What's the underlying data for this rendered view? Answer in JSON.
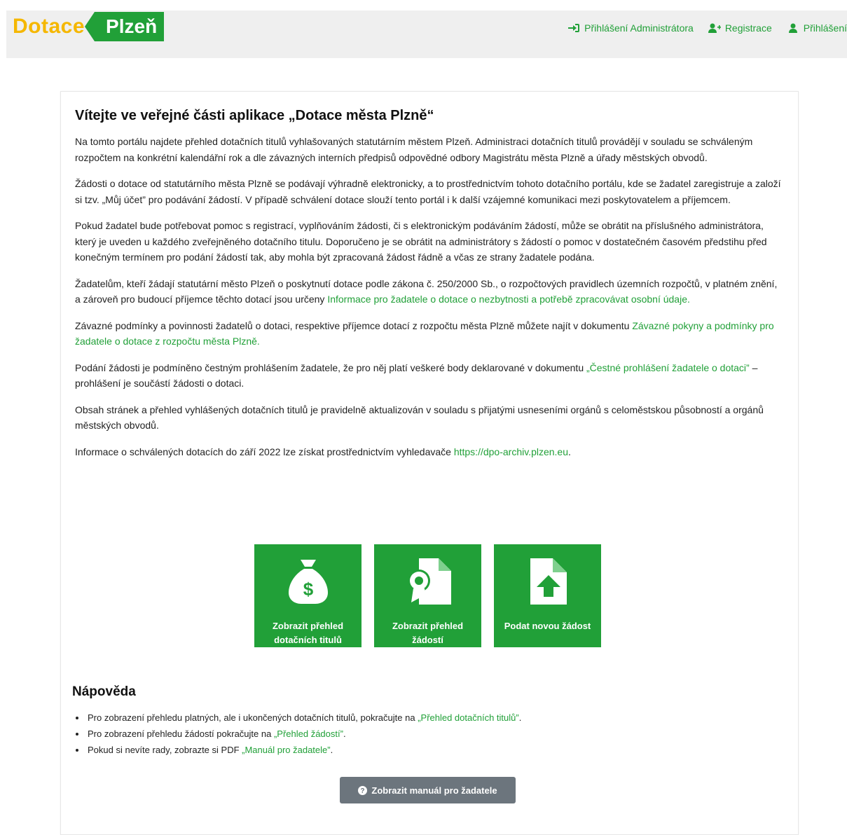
{
  "header": {
    "logo": {
      "word": "Dotace",
      "tag": "Plzeň"
    },
    "links": [
      {
        "label": "Přihlášení Administrátora",
        "icon": "sign-in-icon"
      },
      {
        "label": "Registrace",
        "icon": "user-plus-icon"
      },
      {
        "label": "Přihlášení",
        "icon": "user-icon"
      }
    ]
  },
  "main": {
    "title": "Vítejte ve veřejné části aplikace „Dotace města Plzně“",
    "p1": "Na tomto portálu najdete přehled dotačních titulů vyhlašovaných statutárním městem Plzeň. Administraci dotačních titulů provádějí v souladu se schváleným rozpočtem na konkrétní kalendářní rok a dle závazných interních předpisů odpovědné odbory Magistrátu města Plzně a úřady městských obvodů.",
    "p2": "Žádosti o dotace od statutárního města Plzně se podávají výhradně elektronicky, a to prostřednictvím tohoto dotačního portálu, kde se žadatel zaregistruje a založí si tzv. „Můj účet” pro podávání žádostí. V případě schválení dotace slouží tento portál i k další vzájemné komunikaci mezi poskytovatelem a příjemcem.",
    "p3": "Pokud žadatel bude potřebovat pomoc s registrací, vyplňováním žádosti, či s elektronickým podáváním žádostí, může se obrátit na příslušného administrátora, který je uveden u každého zveřejněného dotačního titulu. Doporučeno je se obrátit na administrátory s žádostí o pomoc v dostatečném časovém předstihu před konečným termínem pro podání žádostí tak, aby mohla být zpracovaná žádost řádně a včas ze strany žadatele podána.",
    "p4_text": "Žadatelům, kteří žádají statutární město Plzeň o poskytnutí dotace podle zákona č. 250/2000 Sb., o rozpočtových pravidlech územních rozpočtů, v platném znění, a zároveň pro budoucí příjemce těchto dotací jsou určeny ",
    "p4_link": "Informace pro žadatele o dotace o nezbytnosti a potřebě zpracovávat osobní údaje.",
    "p5_text": "Závazné podmínky a povinnosti žadatelů o dotaci, respektive příjemce dotací z rozpočtu města Plzně můžete najít v dokumentu ",
    "p5_link": "Závazné pokyny a podmínky pro žadatele o dotace z rozpočtu města Plzně.",
    "p6_text": "Podání žádosti je podmíněno čestným prohlášením žadatele, že pro něj platí veškeré body deklarované v dokumentu ",
    "p6_link": "„Čestné prohlášení žadatele o dotaci”",
    "p6_tail": " – prohlášení je součástí žádosti o dotaci.",
    "p7": "Obsah stránek a přehled vyhlášených dotačních titulů je pravidelně aktualizován v souladu s přijatými usneseními orgánů s celoměstskou působností a orgánů městských obvodů.",
    "p8_text": "Informace o schválených dotacích do září 2022 lze získat prostřednictvím vyhledavače ",
    "p8_link": "https://dpo-archiv.plzen.eu",
    "p8_tail": "."
  },
  "tiles": [
    {
      "label": "Zobrazit přehled dotačních titulů",
      "icon": "money-bag-icon"
    },
    {
      "label": "Zobrazit přehled žádostí",
      "icon": "certificate-file-icon"
    },
    {
      "label": "Podat novou žádost",
      "icon": "file-upload-icon"
    }
  ],
  "help": {
    "title": "Nápověda",
    "items": [
      {
        "text": "Pro zobrazení přehledu platných, ale i ukončených dotačních titulů, pokračujte na ",
        "link": "„Přehled dotačních titulů”",
        "tail": "."
      },
      {
        "text": "Pro zobrazení přehledu žádostí pokračujte na ",
        "link": "„Přehled žádostí”",
        "tail": "."
      },
      {
        "text": "Pokud si nevíte rady, zobrazte si PDF ",
        "link": "„Manuál pro žadatele”",
        "tail": "."
      }
    ],
    "button_label": "Zobrazit manuál pro žadatele"
  },
  "colors": {
    "brand_green": "#21a038",
    "brand_yellow": "#f5b700",
    "button_gray": "#6c757d"
  }
}
